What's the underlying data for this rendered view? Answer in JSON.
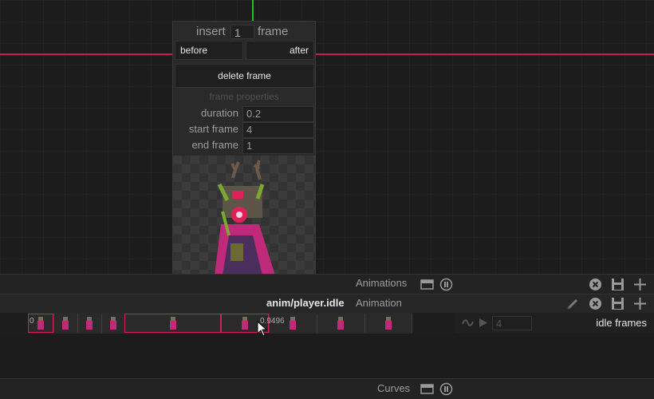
{
  "popup": {
    "insert_label": "insert",
    "insert_value": "1",
    "frame_label": "frame",
    "before_label": "before",
    "after_label": "after",
    "delete_label": "delete frame",
    "props_header": "frame properties",
    "duration_label": "duration",
    "duration_value": "0.2",
    "start_label": "start frame",
    "start_value": "4",
    "end_label": "end frame",
    "end_value": "1"
  },
  "animations_panel": {
    "title": "Animations"
  },
  "anim_header": {
    "path": "anim/player.idle",
    "type": "Animation"
  },
  "timeline": {
    "time_left": "0",
    "time_marker": "0.9496",
    "frames_value": "4",
    "frames_label": "idle frames"
  },
  "curves_panel": {
    "title": "Curves"
  },
  "colors": {
    "accent": "#d81d55",
    "green_axis": "#21c321",
    "background": "#1c1c1c"
  },
  "icons": [
    "collapse-icon",
    "info-icon",
    "close-icon",
    "save-icon",
    "add-icon",
    "pencil-icon",
    "loop-icon",
    "play-icon",
    "mouse-cursor-icon"
  ]
}
